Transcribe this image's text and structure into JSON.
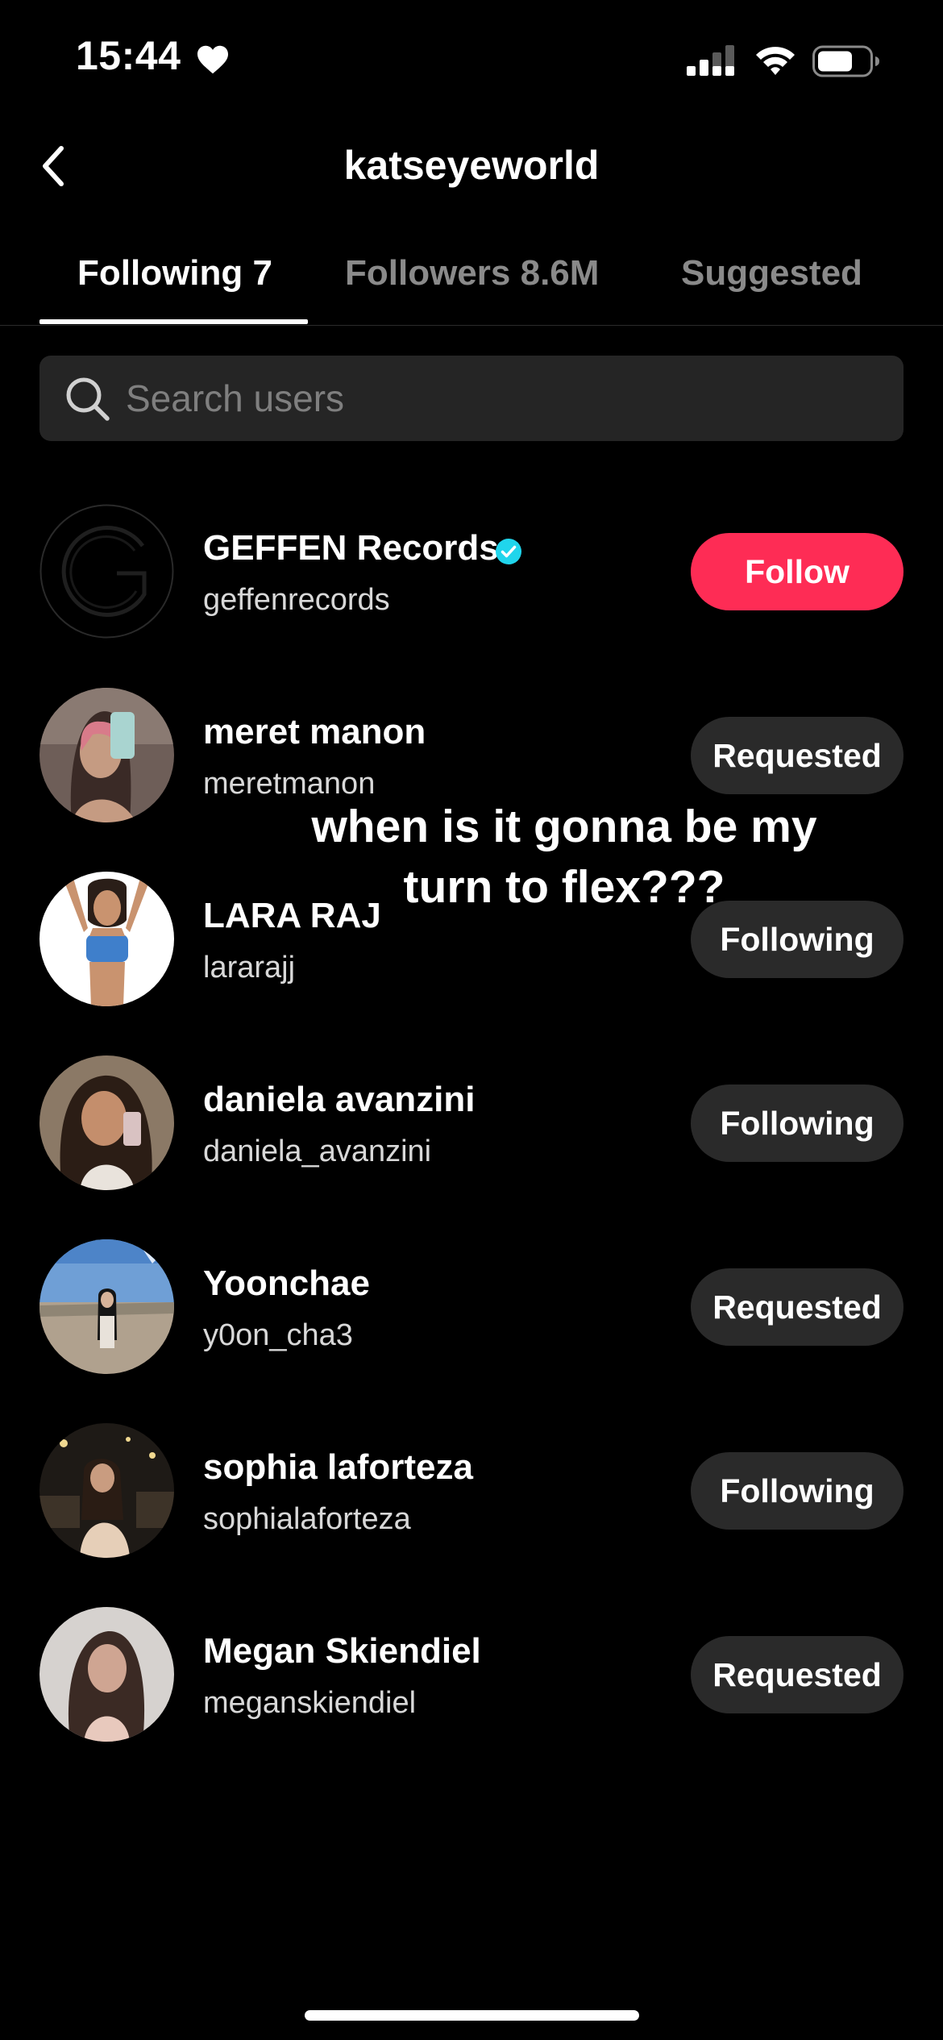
{
  "status_bar": {
    "time": "15:44",
    "icons": [
      "heart-icon",
      "cellular-signal-icon",
      "wifi-icon",
      "battery-icon"
    ]
  },
  "header": {
    "back_icon": "chevron-left-icon",
    "title": "katseyeworld"
  },
  "tabs": [
    {
      "label": "Following 7",
      "active": true
    },
    {
      "label": "Followers 8.6M",
      "active": false
    },
    {
      "label": "Suggested",
      "active": false
    }
  ],
  "search": {
    "placeholder": "Search users",
    "value": "",
    "icon": "search-icon"
  },
  "users": [
    {
      "name": "GEFFEN Records",
      "handle": "geffenrecords",
      "verified": true,
      "button": "Follow"
    },
    {
      "name": "meret manon",
      "handle": "meretmanon",
      "verified": false,
      "button": "Requested"
    },
    {
      "name": "LARA RAJ",
      "handle": "lararajj",
      "verified": false,
      "button": "Following"
    },
    {
      "name": "daniela avanzini",
      "handle": "daniela_avanzini",
      "verified": false,
      "button": "Following"
    },
    {
      "name": "Yoonchae",
      "handle": "y0on_cha3",
      "verified": false,
      "button": "Requested"
    },
    {
      "name": "sophia laforteza",
      "handle": "sophialaforteza",
      "verified": false,
      "button": "Following"
    },
    {
      "name": "Megan Skiendiel",
      "handle": "meganskiendiel",
      "verified": false,
      "button": "Requested"
    }
  ],
  "overlay_caption": {
    "line1": "when is it gonna be my",
    "line2": "turn to flex???"
  },
  "colors": {
    "background": "#000000",
    "follow_button": "#fe2c55",
    "secondary_button": "#2a2a2a",
    "verified_badge": "#20d5ec",
    "inactive_tab": "#8a8a8a"
  }
}
